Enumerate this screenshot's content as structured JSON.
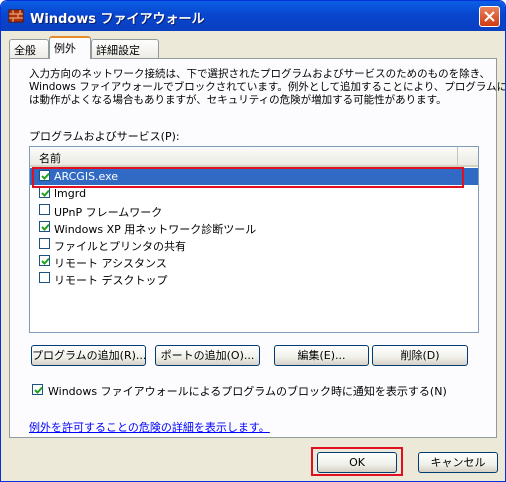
{
  "window": {
    "title": "Windows ファイアウォール",
    "icon": "firewall-icon"
  },
  "tabs": [
    {
      "label": "全般",
      "active": false
    },
    {
      "label": "例外",
      "active": true
    },
    {
      "label": "詳細設定",
      "active": false
    }
  ],
  "description": [
    "入力方向のネットワーク接続は、下で選択されたプログラムおよびサービスのためのものを除き、",
    "Windows ファイアウォールでブロックされています。例外として追加することにより、プログラムによって",
    "は動作がよくなる場合もありますが、セキュリティの危険が増加する可能性があります。"
  ],
  "list": {
    "label": "プログラムおよびサービス(P):",
    "column_header": "名前",
    "items": [
      {
        "label": "ARCGIS.exe",
        "checked": true,
        "selected": true
      },
      {
        "label": "lmgrd",
        "checked": true,
        "selected": false
      },
      {
        "label": "UPnP フレームワーク",
        "checked": false,
        "selected": false
      },
      {
        "label": "Windows XP 用ネットワーク診断ツール",
        "checked": true,
        "selected": false
      },
      {
        "label": "ファイルとプリンタの共有",
        "checked": false,
        "selected": false
      },
      {
        "label": "リモート アシスタンス",
        "checked": true,
        "selected": false
      },
      {
        "label": "リモート デスクトップ",
        "checked": false,
        "selected": false
      }
    ]
  },
  "buttons": {
    "add_program": "プログラムの追加(R)...",
    "add_port": "ポートの追加(O)...",
    "edit": "編集(E)...",
    "delete": "削除(D)"
  },
  "notify": {
    "label": "Windows ファイアウォールによるプログラムのブロック時に通知を表示する(N)",
    "checked": true
  },
  "link": "例外を許可することの危険の詳細を表示します。",
  "footer": {
    "ok": "OK",
    "cancel": "キャンセル"
  },
  "colors": {
    "highlight": "#e01020",
    "selection": "#316ac5",
    "titlebar": "#0a5fe6"
  }
}
